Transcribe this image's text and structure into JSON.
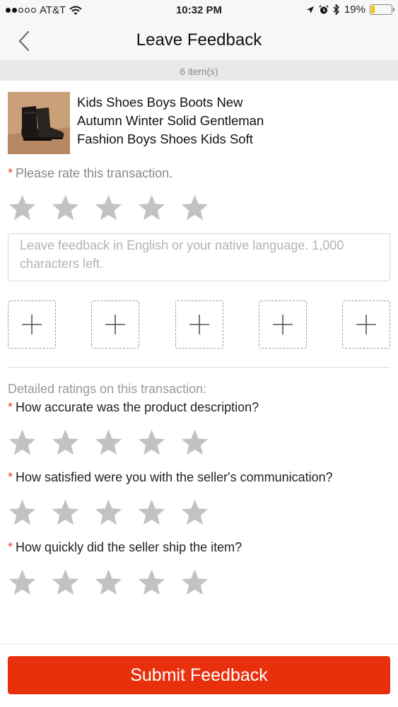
{
  "status_bar": {
    "carrier": "AT&T",
    "time": "10:32 PM",
    "battery_percent": "19%",
    "battery_level": 0.19,
    "icons": [
      "signal-dots-icon",
      "wifi-icon",
      "location-arrow-icon",
      "alarm-icon",
      "bluetooth-icon",
      "battery-icon"
    ]
  },
  "nav": {
    "title": "Leave Feedback",
    "back_icon": "chevron-left-icon"
  },
  "item_count": "6 item(s)",
  "product": {
    "title": "Kids Shoes Boys Boots New\nAutumn Winter Solid  Gentleman\nFashion Boys Shoes Kids Soft"
  },
  "overall_rating": {
    "required_mark": "*",
    "prompt": "Please rate this transaction.",
    "stars_selected": 0,
    "stars_total": 5
  },
  "feedback": {
    "placeholder": "Leave feedback in English or your native language. 1,000 characters left.",
    "value": ""
  },
  "photos": {
    "slots": 5,
    "add_icon": "plus-icon"
  },
  "detailed": {
    "heading": "Detailed ratings on this transaction:",
    "questions": [
      {
        "required_mark": "*",
        "text": "How accurate was the product description?",
        "stars_selected": 0
      },
      {
        "required_mark": "*",
        "text": "How satisfied were you with the seller's communication?",
        "stars_selected": 0
      },
      {
        "required_mark": "*",
        "text": "How quickly did the seller ship the item?",
        "stars_selected": 0
      }
    ]
  },
  "submit_label": "Submit Feedback",
  "colors": {
    "accent": "#e8300d",
    "required": "#e8492b",
    "star_empty": "#c2c2c2",
    "nav_bg": "#f7f7f7",
    "battery": "#f2c600"
  }
}
